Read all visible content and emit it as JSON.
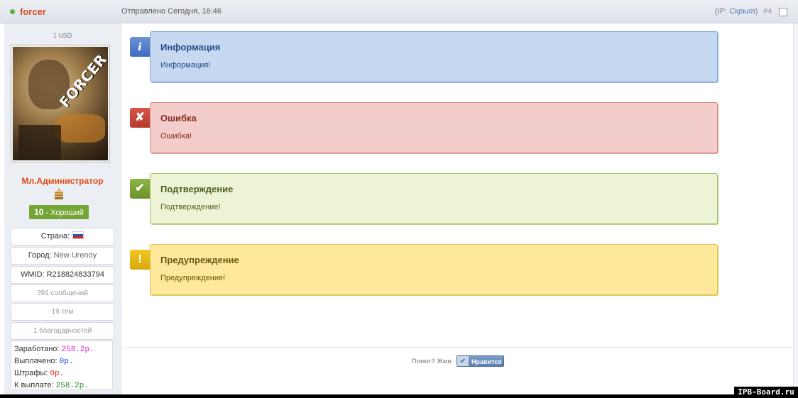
{
  "header": {
    "author": "forcer",
    "posted": "Отправлено Сегодня, 16:46",
    "ip_prefix": "(IP: ",
    "ip_value": "Скрыт",
    "ip_suffix": ")",
    "post_number": "#4"
  },
  "sidebar": {
    "usd": "1 USD",
    "avatar_text": "FORCER",
    "rank": "Мл.Администратор",
    "reputation_value": "10",
    "reputation_label": " - Хороший",
    "country_label": "Страна:",
    "city_label": "Город:",
    "city_value": "New Urenoy",
    "wmid": "WMID: R218824833794",
    "posts": "391 сообщений",
    "topics": "19 тем",
    "thanks": "1 благодарностей",
    "money": {
      "earned_label": "Заработано:",
      "earned_value": "258.2р.",
      "paid_label": "Выплачено:",
      "paid_value": "0р.",
      "fines_label": "Штрафы:",
      "fines_value": "0р.",
      "payout_label": "К выплате:",
      "payout_value": "258.2р."
    }
  },
  "alerts": {
    "info_title": "Информация",
    "info_text": "Информация!",
    "error_title": "Ошибка",
    "error_text": "Ошибка!",
    "ok_title": "Подтверждение",
    "ok_text": "Подтверждение!",
    "warn_title": "Предупреждение",
    "warn_text": "Предупреждение!",
    "icons": {
      "info": "i",
      "error": "✘",
      "ok": "✔",
      "warn": "!"
    }
  },
  "footer": {
    "helped": "Помог? Жми",
    "like": "Нравится",
    "watermark": "IPB-Board.ru"
  },
  "colors": {
    "author": "#d64a1e",
    "rank": "#e04a14",
    "earned": "#e020c8",
    "paid": "#1d3fd6",
    "fines": "#e01f1f",
    "payout": "#1f8a1f"
  }
}
